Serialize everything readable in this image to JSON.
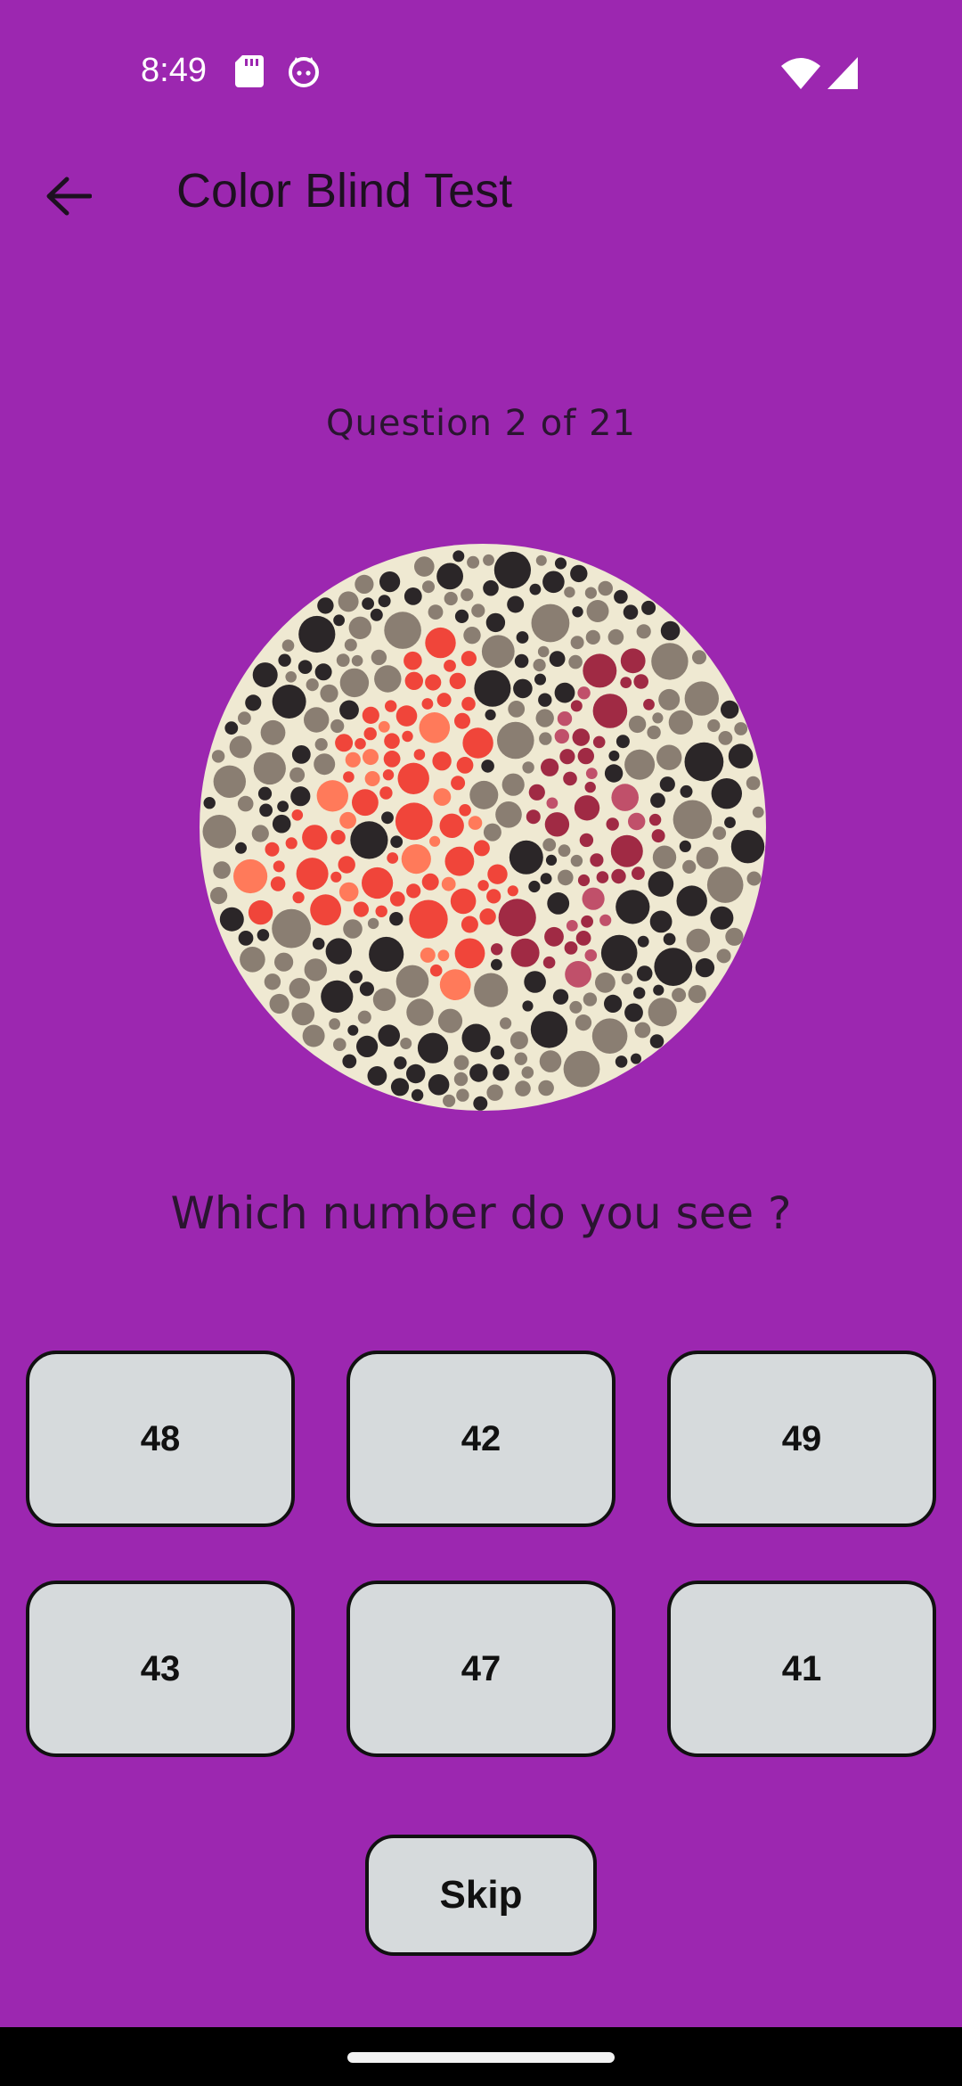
{
  "status_bar": {
    "time": "8:49",
    "icons": [
      "sd-card-icon",
      "cat-face-icon",
      "wifi-icon",
      "cell-signal-icon"
    ]
  },
  "app_bar": {
    "title": "Color Blind Test",
    "back_icon": "arrow-back-icon"
  },
  "quiz": {
    "counter": "Question 2 of 21",
    "prompt": "Which number do you see ?",
    "options": [
      "48",
      "42",
      "49",
      "43",
      "47",
      "41"
    ],
    "skip_label": "Skip"
  },
  "colors": {
    "background": "#9C27B0",
    "button_fill": "#D6DADC",
    "button_border": "#111111",
    "plate_dark": "#2b2628",
    "plate_grey": "#8a7e72",
    "plate_light": "#efe9d2",
    "plate_red": "#f0453a",
    "plate_maroon": "#a02a44"
  }
}
